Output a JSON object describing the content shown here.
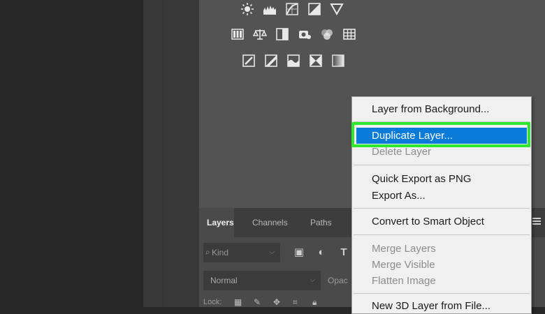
{
  "menu": {
    "items": [
      {
        "label": "Layer from Background...",
        "enabled": true
      },
      {
        "label": "Duplicate Layer...",
        "enabled": true,
        "highlighted": true
      },
      {
        "label": "Delete Layer",
        "enabled": false
      },
      {
        "label": "Quick Export as PNG",
        "enabled": true
      },
      {
        "label": "Export As...",
        "enabled": true
      },
      {
        "label": "Convert to Smart Object",
        "enabled": true
      },
      {
        "label": "Merge Layers",
        "enabled": false
      },
      {
        "label": "Merge Visible",
        "enabled": false
      },
      {
        "label": "Flatten Image",
        "enabled": false
      },
      {
        "label": "New 3D Layer from File...",
        "enabled": true
      }
    ]
  },
  "layers_panel": {
    "tabs": [
      {
        "label": "Layers",
        "active": true
      },
      {
        "label": "Channels",
        "active": false
      },
      {
        "label": "Paths",
        "active": false
      }
    ],
    "filter": {
      "kind_label": "Kind"
    },
    "blend_mode": "Normal",
    "opacity_label": "Opac",
    "lock_label": "Lock:"
  },
  "adjustments": {
    "rows": [
      [
        "brightness-contrast-icon",
        "levels-icon",
        "curves-icon",
        "exposure-icon",
        "gradient-triangle-icon"
      ],
      [
        "vibrance-icon",
        "color-balance-icon",
        "black-white-icon",
        "photo-filter-icon",
        "channel-mixer-icon",
        "color-lookup-icon"
      ],
      [
        "invert-icon",
        "posterize-icon",
        "threshold-icon",
        "selective-color-icon",
        "gradient-map-icon"
      ]
    ]
  },
  "colors": {
    "highlight": "#0a7bd8",
    "focus_ring": "#2ee82e",
    "panel_bg": "#535353"
  }
}
